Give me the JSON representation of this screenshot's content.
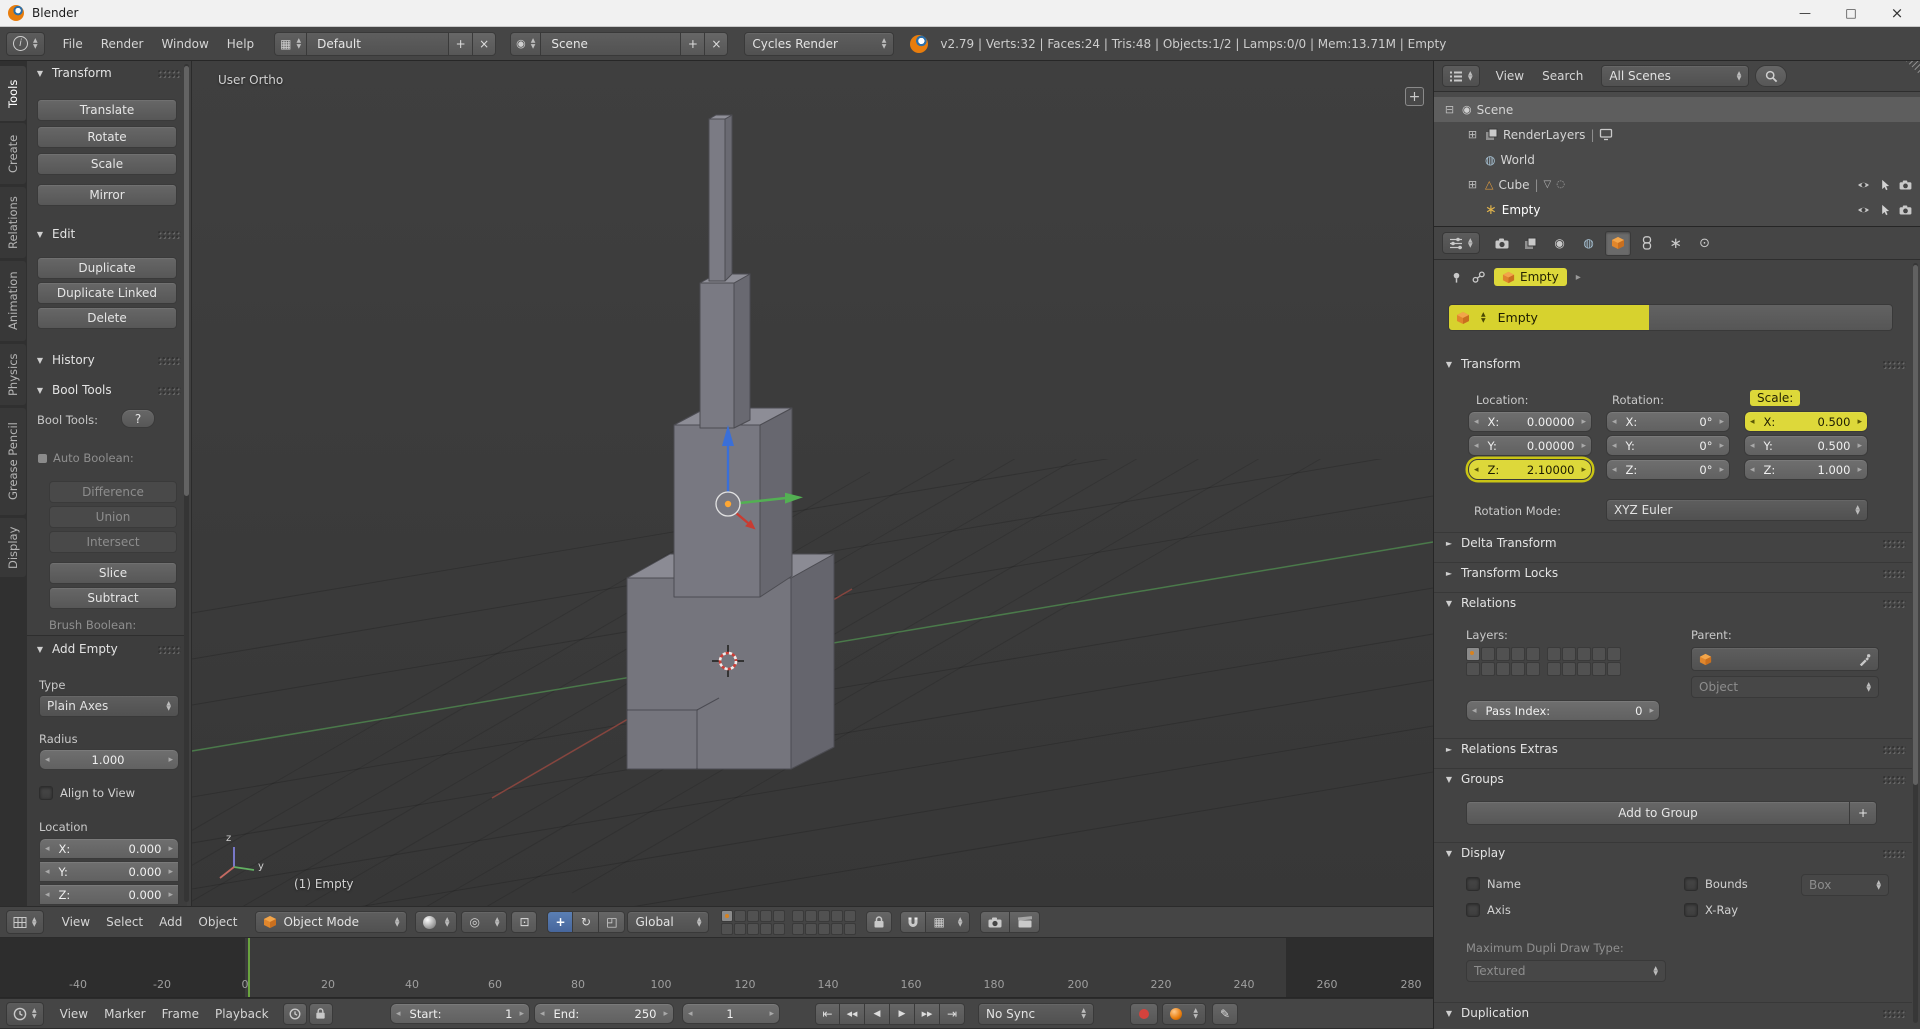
{
  "icons": {
    "tri_open": "▼",
    "tri_closed": "►",
    "min": "—",
    "max": "□",
    "close": "×",
    "plus": "+",
    "x": "×",
    "pipe": "|",
    "help": "?",
    "info": "i",
    "grid": "▦",
    "ball": "◉",
    "tree_open": "⊟",
    "tree_closed": "⊞",
    "world": "◍",
    "mesh": "△",
    "empty_axes": "∗",
    "mesh_data": "▽",
    "dot_small": "◌",
    "pivot": "◎",
    "align": "⊡",
    "translate": "+",
    "rotate": "↻",
    "scale": "◰",
    "skip_start": "⇤",
    "prev_key": "◀◀",
    "play_rev": "◀",
    "play": "▶",
    "next_key": "▶▶",
    "skip_end": "⇥",
    "key": "✎",
    "chevron": "▸",
    "scene_tab": "◉",
    "world_tab": "◍",
    "data_tab": "∗",
    "physics_tab": "⊙"
  },
  "titlebar": {
    "title": "Blender"
  },
  "infobar": {
    "menus": [
      "File",
      "Render",
      "Window",
      "Help"
    ],
    "layout": "Default",
    "scene": "Scene",
    "engine": "Cycles Render",
    "stats": "v2.79 | Verts:32 | Faces:24 | Tris:48 | Objects:1/2 | Lamps:0/0 | Mem:13.71M | Empty"
  },
  "tool_tabs": {
    "items": [
      "Tools",
      "Create",
      "Relations",
      "Animation",
      "Physics",
      "Grease Pencil",
      "Display"
    ]
  },
  "shelf": {
    "transform": {
      "title": "Transform",
      "b0": "Translate",
      "b1": "Rotate",
      "b2": "Scale",
      "b3": "Mirror"
    },
    "edit": {
      "title": "Edit",
      "b0": "Duplicate",
      "b1": "Duplicate Linked",
      "b2": "Delete"
    },
    "history": {
      "title": "History"
    },
    "bool": {
      "title": "Bool Tools",
      "label": "Bool Tools:",
      "auto_label": "Auto Boolean:",
      "b0": "Difference",
      "b1": "Union",
      "b2": "Intersect",
      "b3": "Slice",
      "b4": "Subtract",
      "brush_label": "Brush Boolean:"
    },
    "add_empty": {
      "title": "Add Empty",
      "type_label": "Type",
      "type_value": "Plain Axes",
      "radius_label": "Radius",
      "radius_value": "1.000",
      "align_label": "Align to View",
      "loc_label": "Location",
      "xl": "X:",
      "xv": "0.000",
      "yl": "Y:",
      "yv": "0.000",
      "zl": "Z:",
      "zv": "0.000"
    }
  },
  "viewport": {
    "view_label": "User Ortho",
    "object_label": "(1) Empty",
    "axis_z": "z",
    "axis_y": "y"
  },
  "vp_header": {
    "menus": [
      "View",
      "Select",
      "Add",
      "Object"
    ],
    "mode": "Object Mode",
    "orientation": "Global"
  },
  "timeline": {
    "ticks": [
      "-40",
      "-20",
      "0",
      "20",
      "40",
      "60",
      "80",
      "100",
      "120",
      "140",
      "160",
      "180",
      "200",
      "220",
      "240",
      "260",
      "280"
    ],
    "menus": [
      "View",
      "Marker",
      "Frame",
      "Playback"
    ],
    "start_label": "Start:",
    "start_value": "1",
    "end_label": "End:",
    "end_value": "250",
    "frame_value": "1",
    "sync": "No Sync"
  },
  "outliner": {
    "menus": [
      "View",
      "Search"
    ],
    "filter": "All Scenes",
    "rows": [
      {
        "label": "Scene"
      },
      {
        "label": "RenderLayers"
      },
      {
        "label": "World"
      },
      {
        "label": "Cube"
      },
      {
        "label": "Empty"
      }
    ]
  },
  "props": {
    "breadcrumb": "Empty",
    "name": "Empty",
    "transform": {
      "title": "Transform",
      "loc_label": "Location:",
      "rot_label": "Rotation:",
      "scale_label": "Scale:",
      "loc": [
        [
          "X:",
          "0.00000"
        ],
        [
          "Y:",
          "0.00000"
        ],
        [
          "Z:",
          "2.10000"
        ]
      ],
      "rot": [
        [
          "X:",
          "0°"
        ],
        [
          "Y:",
          "0°"
        ],
        [
          "Z:",
          "0°"
        ]
      ],
      "scl": [
        [
          "X:",
          "0.500"
        ],
        [
          "Y:",
          "0.500"
        ],
        [
          "Z:",
          "1.000"
        ]
      ],
      "rotmode_label": "Rotation Mode:",
      "rotmode_value": "XYZ Euler"
    },
    "delta_title": "Delta Transform",
    "locks_title": "Transform Locks",
    "relations": {
      "title": "Relations",
      "layers_label": "Layers:",
      "parent_label": "Parent:",
      "object_value": "Object",
      "pass_label": "Pass Index:",
      "pass_value": "0"
    },
    "extras_title": "Relations Extras",
    "groups": {
      "title": "Groups",
      "add_label": "Add to Group"
    },
    "display": {
      "title": "Display",
      "name_label": "Name",
      "axis_label": "Axis",
      "bounds_label": "Bounds",
      "bounds_value": "Box",
      "xray_label": "X-Ray",
      "dupli_label": "Maximum Dupli Draw Type:",
      "dupli_value": "Textured"
    },
    "duplication_title": "Duplication"
  }
}
